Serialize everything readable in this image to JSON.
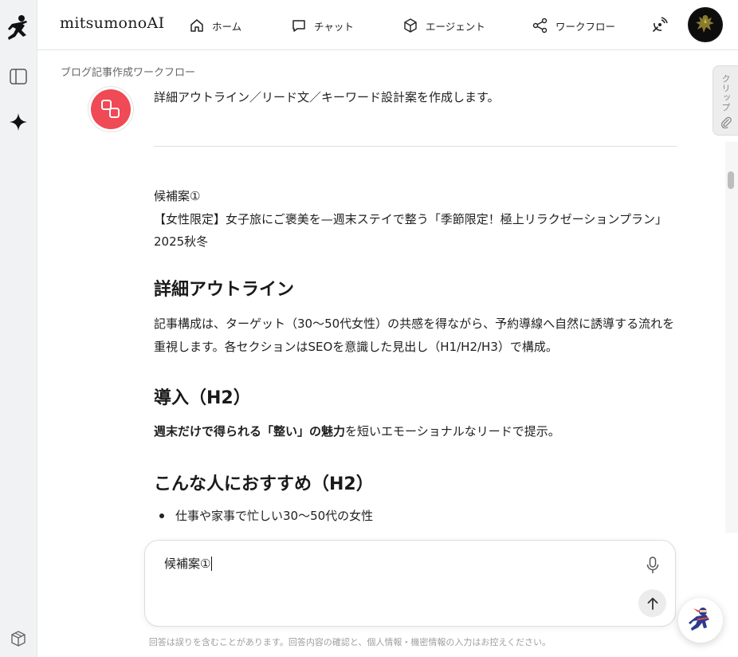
{
  "app": {
    "brand": "mitsumonoAI"
  },
  "nav": [
    {
      "label": "ホーム",
      "icon": "home-icon"
    },
    {
      "label": "チャット",
      "icon": "chat-icon"
    },
    {
      "label": "エージェント",
      "icon": "cube-icon"
    },
    {
      "label": "ワークフロー",
      "icon": "share-icon"
    }
  ],
  "sidebar": {
    "icons": [
      "runner-logo-icon",
      "panel-toggle-icon",
      "sparkle-icon",
      "box-icon"
    ]
  },
  "breadcrumb": "ブログ記事作成ワークフロー",
  "clip": {
    "label": "クリップ"
  },
  "message": {
    "intro": "詳細アウトライン／リード文／キーワード設計案を作成します。",
    "candidate_label": "候補案①",
    "candidate_title": "【女性限定】女子旅にご褒美を—週末ステイで整う「季節限定！極上リラクゼーションプラン」2025秋冬",
    "h_outline": "詳細アウトライン",
    "outline_text": "記事構成は、ターゲット（30〜50代女性）の共感を得ながら、予約導線へ自然に誘導する流れを重視します。各セクションはSEOを意識した見出し（H1/H2/H3）で構成。",
    "h_intro": "導入（H2）",
    "intro_bold": "週末だけで得られる「整い」の魅力",
    "intro_rest": "を短いエモーショナルなリードで提示。",
    "h_recommend": "こんな人におすすめ（H2）",
    "bullets": [
      "仕事や家事で忙しい30〜50代の女性"
    ]
  },
  "composer": {
    "value": "候補案①"
  },
  "disclaimer": "回答は誤りを含むことがあります。回答内容の確認と、個人情報・機密情報の入力はお控えください。",
  "colors": {
    "accent": "#ef4a55",
    "rail": "#f1f2f4"
  }
}
